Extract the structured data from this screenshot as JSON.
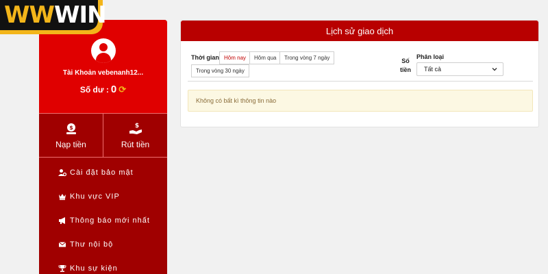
{
  "logo": {
    "part1": "WW",
    "part2": "WIN"
  },
  "sidebar": {
    "account": "Tài Khoản vebenanh12...",
    "balance_label": "Số dư :",
    "balance_value": "0",
    "actions": [
      {
        "label": "Nạp tiền",
        "icon": "deposit-icon"
      },
      {
        "label": "Rút tiền",
        "icon": "withdraw-icon"
      }
    ],
    "menu": [
      {
        "label": "Cài đặt bảo mật",
        "icon": "user-gear-icon"
      },
      {
        "label": "Khu vực VIP",
        "icon": "vip-crown-icon"
      },
      {
        "label": "Thông báo mới nhất",
        "icon": "megaphone-icon"
      },
      {
        "label": "Thư nội bộ",
        "icon": "envelope-icon"
      },
      {
        "label": "Khu sự kiện",
        "icon": "trophy-icon"
      }
    ]
  },
  "panel": {
    "title": "Lịch sử giao dịch",
    "time_label": "Thời gian",
    "time_filters": [
      "Hôm nay",
      "Hôm qua",
      "Trong vòng 7 ngày",
      "Trong vòng 30 ngày"
    ],
    "active_filter": "Hôm nay",
    "amount_label": "Số tiền",
    "category_label": "Phân loại",
    "category_selected": "Tất cả",
    "empty_message": "Không có bất kì thông tin nào"
  },
  "colors": {
    "brand_red": "#e00000",
    "dark_red": "#a00000",
    "header_red": "#b80000",
    "logo_gold": "#f3b51a"
  }
}
